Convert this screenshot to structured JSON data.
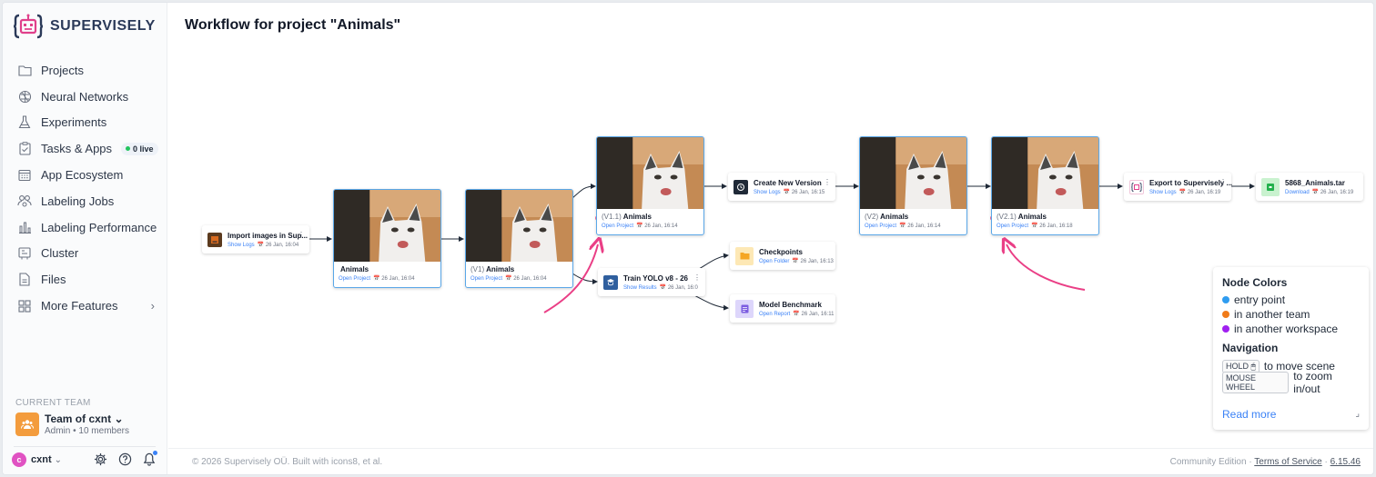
{
  "brand": {
    "name": "SUPERVISELY",
    "accent": "#e0408b"
  },
  "sidebar": {
    "items": [
      {
        "label": "Projects",
        "icon": "folder-icon"
      },
      {
        "label": "Neural Networks",
        "icon": "brain-icon"
      },
      {
        "label": "Experiments",
        "icon": "flask-icon"
      },
      {
        "label": "Tasks & Apps",
        "icon": "clipboard-icon",
        "badge": "0 live"
      },
      {
        "label": "App Ecosystem",
        "icon": "app-grid-icon"
      },
      {
        "label": "Labeling Jobs",
        "icon": "people-icon"
      },
      {
        "label": "Labeling Performance",
        "icon": "bar-chart-icon"
      },
      {
        "label": "Cluster",
        "icon": "server-icon"
      },
      {
        "label": "Files",
        "icon": "file-icon"
      },
      {
        "label": "More Features",
        "icon": "grid-icon",
        "chevron": "›"
      }
    ],
    "team": {
      "section_label": "CURRENT TEAM",
      "name": "Team of cxnt",
      "chevron": "⌄",
      "role": "Admin • 10 members"
    },
    "user": {
      "initial": "c",
      "name": "cxnt",
      "chevron": "⌄"
    }
  },
  "page": {
    "title": "Workflow for project \"Animals\""
  },
  "nodes": {
    "import": {
      "title": "Import images in Sup...",
      "action": "Show Logs",
      "date": "26 Jan, 16:04"
    },
    "proj1": {
      "version": "",
      "title": "Animals",
      "action": "Open Project",
      "date": "26 Jan, 16:04"
    },
    "proj2": {
      "version": "(V1)",
      "title": "Animals",
      "action": "Open Project",
      "date": "26 Jan, 16:04"
    },
    "proj3": {
      "version": "(V1.1)",
      "title": "Animals",
      "action": "Open Project",
      "date": "26 Jan, 16:14"
    },
    "train": {
      "title": "Train YOLO v8 - 26",
      "action": "Show Results",
      "date": "26 Jan, 16:0"
    },
    "checkpoints": {
      "title": "Checkpoints",
      "action": "Open Folder",
      "date": "26 Jan, 16:13"
    },
    "benchmark": {
      "title": "Model Benchmark",
      "action": "Open Report",
      "date": "26 Jan, 16:11"
    },
    "newver": {
      "title": "Create New Version",
      "action": "Show Logs",
      "date": "26 Jan, 16:15"
    },
    "proj4": {
      "version": "(V2)",
      "title": "Animals",
      "action": "Open Project",
      "date": "26 Jan, 16:14"
    },
    "proj5": {
      "version": "(V2.1)",
      "title": "Animals",
      "action": "Open Project",
      "date": "26 Jan, 16:18"
    },
    "export": {
      "title": "Export to Supervisely ...",
      "action": "Show Logs",
      "date": "26 Jan, 16:19"
    },
    "archive": {
      "title": "5868_Animals.tar",
      "action": "Download",
      "date": "26 Jan, 16:19"
    }
  },
  "legend": {
    "colors_title": "Node Colors",
    "colors": [
      {
        "label": "entry point",
        "color": "#2f9cf0"
      },
      {
        "label": "in another team",
        "color": "#f07b1a"
      },
      {
        "label": "in another workspace",
        "color": "#a020f0"
      }
    ],
    "nav_title": "Navigation",
    "nav": [
      {
        "key": "HOLD 🖱",
        "label": "to move scene"
      },
      {
        "key": "MOUSE WHEEL",
        "label": "to zoom in/out"
      }
    ],
    "read_more": "Read more"
  },
  "footer": {
    "left": "© 2026 Supervisely OÜ. Built with icons8, et al.",
    "edition": "Community Edition",
    "sep": " · ",
    "terms": "Terms of Service",
    "version": "6.15.46"
  }
}
